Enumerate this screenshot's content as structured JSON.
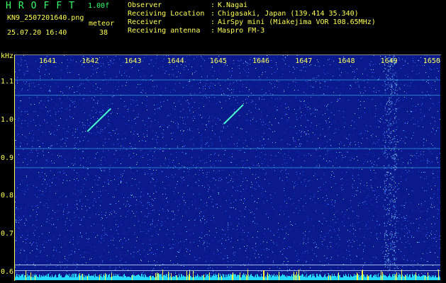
{
  "header": {
    "app_title": "HROFFT",
    "version": "1.00f",
    "filename": "KN9_2507201640.png",
    "datetime": "25.07.20 16:40",
    "meteor_label": "meteor",
    "meteor_count": "38",
    "info": [
      {
        "label": "Observer",
        "value": "K.Nagai"
      },
      {
        "label": "Receiving Location",
        "value": "Chigasaki, Japan (139.414 35.340)"
      },
      {
        "label": "Receiver",
        "value": "AirSpy mini (Miakejima VOR 108.65MHz)"
      },
      {
        "label": "Receiving antenna",
        "value": "Maspro FM-3"
      }
    ]
  },
  "chart_data": {
    "type": "heatmap",
    "ylabel": "kHz",
    "x_ticks": [
      "1641",
      "1642",
      "1643",
      "1644",
      "1645",
      "1646",
      "1647",
      "1648",
      "1649",
      "1650"
    ],
    "y_ticks": [
      "1.1",
      "1.0",
      "0.9",
      "0.8",
      "0.7",
      "0.6"
    ],
    "ylim": [
      0.58,
      1.17
    ],
    "background_color": "#0a1a8c",
    "echo_color": "#44ffcc",
    "horizontal_lines_khz": [
      1.105,
      1.065,
      0.925,
      0.875,
      0.62,
      0.605
    ],
    "echoes": [
      {
        "x_start": 1642.0,
        "x_end": 1642.55,
        "y_start": 0.97,
        "y_end": 1.03
      },
      {
        "x_start": 1645.2,
        "x_end": 1645.65,
        "y_start": 0.99,
        "y_end": 1.04
      }
    ]
  }
}
